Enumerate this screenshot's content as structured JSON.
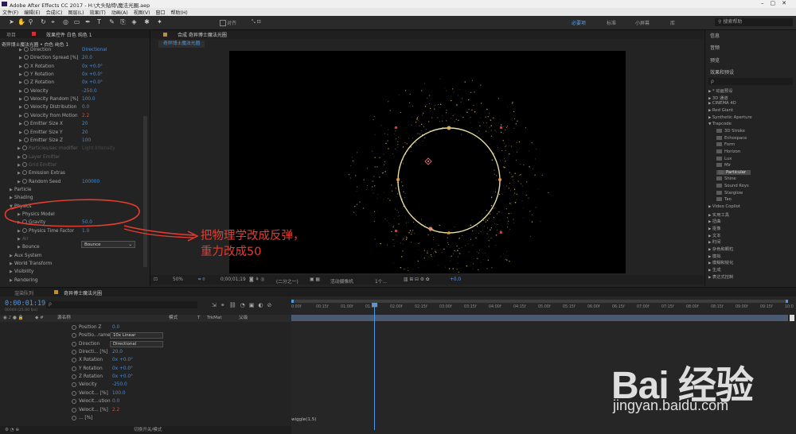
{
  "titlebar": {
    "title": "Adobe After Effects CC 2017 - H:\\大头贴特\\魔法光圈.aep"
  },
  "menu": [
    "文件(F)",
    "编辑(E)",
    "合成(C)",
    "图层(L)",
    "效果(T)",
    "动画(A)",
    "视图(V)",
    "窗口",
    "帮助(H)"
  ],
  "toolbar": {
    "snap_label": "对齐",
    "workspaces": [
      "必要项",
      "标准",
      "小屏幕",
      "库"
    ],
    "search_placeholder": "搜索帮助"
  },
  "left_panel": {
    "tabs": [
      "项目",
      "效果控件 白色 纯色 1"
    ],
    "breadcrumb": "奇异博士魔法光圈 • 白色 纯色 1",
    "properties": [
      {
        "label": "Direction",
        "value": "Directional",
        "indent": 2
      },
      {
        "label": "Direction Spread [%]",
        "value": "20.0",
        "indent": 2
      },
      {
        "label": "X Rotation",
        "value": "0x +0.0°",
        "indent": 2
      },
      {
        "label": "Y Rotation",
        "value": "0x +0.0°",
        "indent": 2
      },
      {
        "label": "Z Rotation",
        "value": "0x +0.0°",
        "indent": 2
      },
      {
        "label": "Velocity",
        "value": "-250.0",
        "indent": 2
      },
      {
        "label": "Velocity Random [%]",
        "value": "100.0",
        "indent": 2
      },
      {
        "label": "Velocity Distribution",
        "value": "0.0",
        "indent": 2
      },
      {
        "label": "Velocity from Motion",
        "value": "2.2",
        "indent": 2,
        "red": true
      },
      {
        "label": "Emitter Size X",
        "value": "20",
        "indent": 2
      },
      {
        "label": "Emitter Size Y",
        "value": "20",
        "indent": 2
      },
      {
        "label": "Emitter Size Z",
        "value": "100",
        "indent": 2
      },
      {
        "label": "Particles/sec modifier",
        "value": "Light Intensity",
        "indent": 1,
        "dim": true
      },
      {
        "label": "Layer Emitter",
        "value": "",
        "indent": 1,
        "dim": true
      },
      {
        "label": "Grid Emitter",
        "value": "",
        "indent": 1,
        "dim": true
      },
      {
        "label": "Emission Extras",
        "value": "",
        "indent": 1
      },
      {
        "label": "Random Seed",
        "value": "100000",
        "indent": 1
      },
      {
        "label": "Particle",
        "value": "",
        "indent": 0
      },
      {
        "label": "Shading",
        "value": "",
        "indent": 0
      },
      {
        "label": "Physics",
        "value": "",
        "indent": 0,
        "open": true
      },
      {
        "label": "Physics Model",
        "value": "",
        "indent": 1
      },
      {
        "label": "Gravity",
        "value": "50.0",
        "indent": 1
      },
      {
        "label": "Physics Time Factor",
        "value": "1.0",
        "indent": 1
      },
      {
        "label": "Air",
        "value": "",
        "indent": 1,
        "dim": true
      },
      {
        "label": "Bounce",
        "value": "",
        "indent": 1
      },
      {
        "label": "Aux System",
        "value": "",
        "indent": 0
      },
      {
        "label": "World Transform",
        "value": "",
        "indent": 0
      },
      {
        "label": "Visibility",
        "value": "",
        "indent": 0
      },
      {
        "label": "Rendering",
        "value": "",
        "indent": 0
      }
    ],
    "physics_model_value": "Bounce"
  },
  "comp": {
    "tab_label": "合成 奇异博士魔法光圈",
    "sub_tab": "奇异博士魔法光圈",
    "zoom": "50%",
    "timecode": "0;00;01;19",
    "resolution": "(二分之一)",
    "camera": "活动摄像机",
    "views": "1个...",
    "exposure": "+0.0"
  },
  "right_panel": {
    "sections": [
      "信息",
      "音频",
      "预览",
      "效果和预设"
    ],
    "search_placeholder": "ρ",
    "effects": [
      {
        "label": "* 动画预设",
        "kind": "cat"
      },
      {
        "label": "3D 通道",
        "kind": "cat"
      },
      {
        "label": "CINEMA 4D",
        "kind": "cat"
      },
      {
        "label": "Red Giant",
        "kind": "cat"
      },
      {
        "label": "Synthetic Aperture",
        "kind": "cat"
      },
      {
        "label": "Trapcode",
        "kind": "open"
      },
      {
        "label": "3D Stroke",
        "kind": "fx"
      },
      {
        "label": "Echospace",
        "kind": "fx"
      },
      {
        "label": "Form",
        "kind": "fx"
      },
      {
        "label": "Horizon",
        "kind": "fx"
      },
      {
        "label": "Lux",
        "kind": "fx"
      },
      {
        "label": "Mir",
        "kind": "fx"
      },
      {
        "label": "Particular",
        "kind": "fx",
        "selected": true
      },
      {
        "label": "Shine",
        "kind": "fx"
      },
      {
        "label": "Sound Keys",
        "kind": "fx"
      },
      {
        "label": "Starglow",
        "kind": "fx"
      },
      {
        "label": "Tao",
        "kind": "fx"
      },
      {
        "label": "Video Copilot",
        "kind": "cat"
      },
      {
        "label": "实用工具",
        "kind": "cat"
      },
      {
        "label": "扭曲",
        "kind": "cat"
      },
      {
        "label": "抠像",
        "kind": "cat"
      },
      {
        "label": "文本",
        "kind": "cat"
      },
      {
        "label": "时间",
        "kind": "cat"
      },
      {
        "label": "杂色和颗粒",
        "kind": "cat"
      },
      {
        "label": "模拟",
        "kind": "cat"
      },
      {
        "label": "模糊和锐化",
        "kind": "cat"
      },
      {
        "label": "生成",
        "kind": "cat"
      },
      {
        "label": "表达式控制",
        "kind": "cat"
      }
    ]
  },
  "timeline": {
    "tabs": [
      "渲染队列",
      "奇异博士魔法光圈"
    ],
    "timecode": "0:00:01:19",
    "frame_info": "00049 (25.00 fps)",
    "columns": [
      "源名称",
      "模式",
      "T",
      "TrkMat",
      "父级"
    ],
    "rows": [
      {
        "label": "Position Z",
        "value": "0.0"
      },
      {
        "label": "Positio...rame",
        "dropdown": "10x Linear"
      },
      {
        "label": "Direction",
        "dropdown": "Directional"
      },
      {
        "label": "Directi... [%]",
        "value": "20.0"
      },
      {
        "label": "X Rotation",
        "value": "0x +0.0°"
      },
      {
        "label": "Y Rotation",
        "value": "0x +0.0°"
      },
      {
        "label": "Z Rotation",
        "value": "0x +0.0°"
      },
      {
        "label": "Velocity",
        "value": "-250.0"
      },
      {
        "label": "Velocit... [%]",
        "value": "100.0"
      },
      {
        "label": "Velocit...ution",
        "value": "0.0"
      },
      {
        "label": "Velocit... [%]",
        "value": "2.2",
        "red": true
      },
      {
        "label": "... [%]",
        "value": ""
      }
    ],
    "ruler": [
      "0:00f",
      "00:15f",
      "01:00f",
      "01:15f",
      "02:00f",
      "02:15f",
      "03:00f",
      "03:15f",
      "04:00f",
      "04:15f",
      "05:00f",
      "05:15f",
      "06:00f",
      "06:15f",
      "07:00f",
      "07:15f",
      "08:00f",
      "08:15f",
      "09:00f",
      "09:15f",
      "10:0"
    ],
    "expression": "wiggle(1,5)",
    "footer_label": "切换开关/模式"
  },
  "annotation": {
    "line1": "把物理学改成反弹，",
    "line2": "重力改成50",
    "color": "#e43c30"
  },
  "watermark": {
    "brand": "Bai 经验",
    "url": "jingyan.baidu.com"
  }
}
